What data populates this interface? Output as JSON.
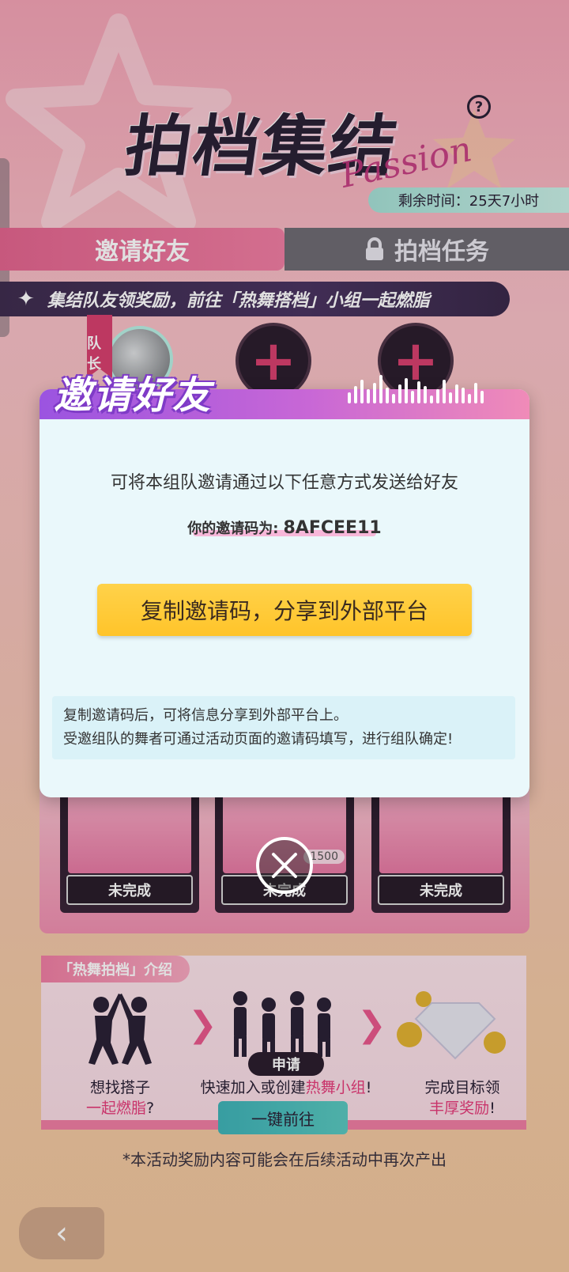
{
  "header": {
    "title": "拍档集结",
    "subtitle_script": "Passion",
    "remaining_time": "剩余时间：25天7小时"
  },
  "tabs": [
    {
      "label": "邀请好友",
      "active": true
    },
    {
      "label": "拍档任务",
      "locked": true
    }
  ],
  "banner": "集结队友领奖励，前往「热舞搭档」小组一起燃脂",
  "team": {
    "leader_badge": "队长"
  },
  "rewards": [
    {
      "status": "未完成"
    },
    {
      "status": "未完成",
      "coin_count": "1500"
    },
    {
      "status": "未完成"
    }
  ],
  "intro": {
    "tag": "「热舞拍档」介绍",
    "steps": [
      {
        "line1": "想找搭子",
        "line2_highlight": "一起燃脂",
        "line2_suffix": "?"
      },
      {
        "line1_prefix": "快速加入或创建",
        "line1_highlight": "热舞小组",
        "line1_suffix": "!"
      },
      {
        "line1": "完成目标领",
        "line2_highlight": "丰厚奖励",
        "line2_suffix": "!"
      }
    ],
    "apply_label": "申请",
    "go_button": "一键前往"
  },
  "disclaimer": "*本活动奖励内容可能会在后续活动中再次产出",
  "modal": {
    "title": "邀请好友",
    "description": "可将本组队邀请通过以下任意方式发送给好友",
    "code_label": "你的邀请码为:",
    "code_value": "8AFCEE11",
    "copy_button": "复制邀请码，分享到外部平台",
    "hint_line1": "复制邀请码后，可将信息分享到外部平台上。",
    "hint_line2": "受邀组队的舞者可通过活动页面的邀请码填写，进行组队确定!"
  },
  "colors": {
    "accent_pink": "#f07ea3",
    "copy_button": "#ffc42a",
    "modal_bg": "#eaf8fb",
    "modal_header_start": "#9b54e0"
  }
}
